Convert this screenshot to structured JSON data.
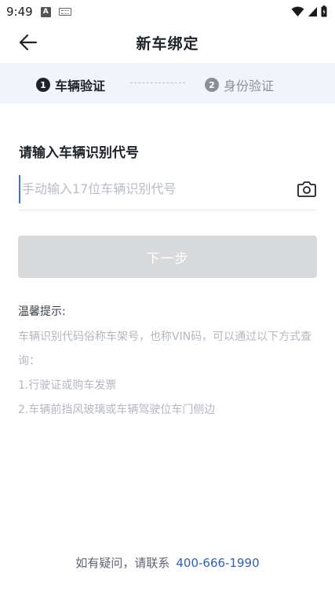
{
  "status_bar": {
    "time": "9:49",
    "notif_icon_letter": "A"
  },
  "header": {
    "title": "新车绑定"
  },
  "stepper": {
    "steps": [
      {
        "num": "1",
        "label": "车辆验证",
        "active": true
      },
      {
        "num": "2",
        "label": "身份验证",
        "active": false
      }
    ]
  },
  "form": {
    "title": "请输入车辆识别代号",
    "vin_placeholder": "手动输入17位车辆识别代号",
    "vin_value": "",
    "next_label": "下一步"
  },
  "tips": {
    "title": "温馨提示:",
    "lines": [
      "车辆识别代码俗称车架号，也称VIN码，可以通过以下方式查询：",
      "1.行驶证或购车发票",
      "2.车辆前挡风玻璃或车辆驾驶位车门侧边"
    ]
  },
  "footer": {
    "contact_text": "如有疑问，请联系",
    "phone": "400-666-1990"
  },
  "colors": {
    "accent": "#2f5fb3",
    "disabled_button": "#d8d9db",
    "stepper_bg": "#f1f4f8"
  }
}
